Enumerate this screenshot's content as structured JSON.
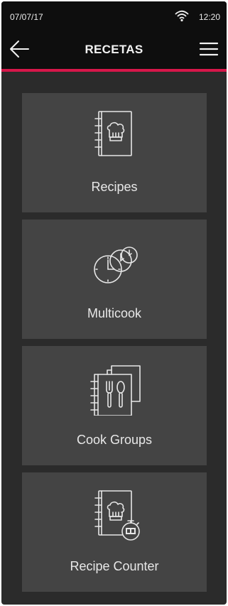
{
  "status": {
    "date": "07/07/17",
    "time": "12:20"
  },
  "header": {
    "title": "RECETAS",
    "back_icon": "arrow-left-icon",
    "menu_icon": "hamburger-menu-icon"
  },
  "colors": {
    "accent": "#d7174a",
    "background": "#2b2b2b",
    "tile": "#444444",
    "bar": "#0e0e0e"
  },
  "menu": {
    "items": [
      {
        "label": "Recipes",
        "icon": "recipe-book-chef-hat-icon"
      },
      {
        "label": "Multicook",
        "icon": "multiple-clocks-icon"
      },
      {
        "label": "Cook Groups",
        "icon": "recipe-books-cutlery-icon"
      },
      {
        "label": "Recipe Counter",
        "icon": "recipe-book-counter-icon"
      }
    ]
  }
}
